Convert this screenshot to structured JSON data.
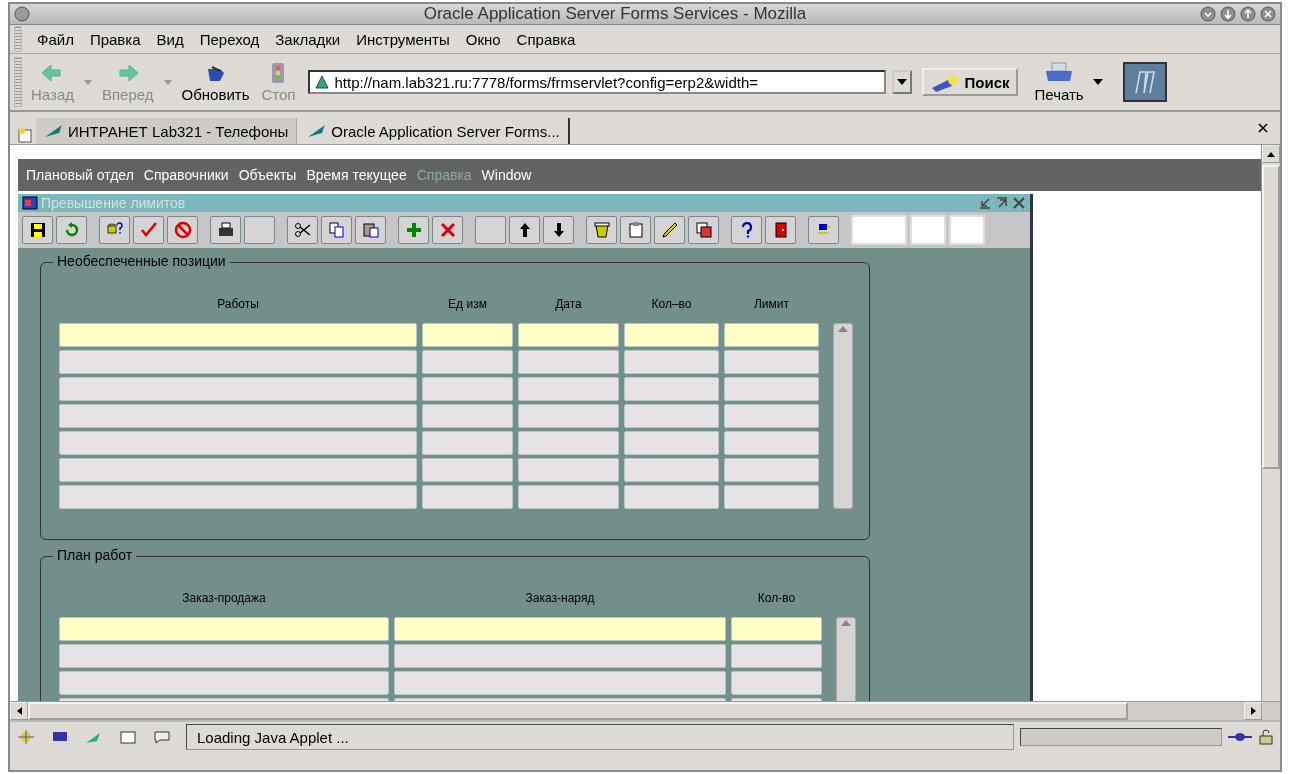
{
  "window": {
    "title": "Oracle Application Server Forms Services - Mozilla"
  },
  "menu": [
    "Файл",
    "Правка",
    "Вид",
    "Переход",
    "Закладки",
    "Инструменты",
    "Окно",
    "Справка"
  ],
  "nav_buttons": [
    {
      "kind": "back",
      "label": "Назад",
      "disabled": true
    },
    {
      "kind": "forward",
      "label": "Вперед",
      "disabled": true
    },
    {
      "kind": "reload",
      "label": "Обновить",
      "disabled": false
    },
    {
      "kind": "stop",
      "label": "Стоп",
      "disabled": true
    }
  ],
  "url": "http://nam.lab321.ru:7778/forms/frmservlet?config=erp2&width=",
  "search_button": "Поиск",
  "print_button": "Печать",
  "tabs": [
    {
      "label": "ИНТРАНЕТ Lab321 - Телефоны",
      "selected": false
    },
    {
      "label": "Oracle Application Server Forms...",
      "selected": true
    }
  ],
  "applet_menu": [
    {
      "label": "Плановый отдел",
      "disabled": false
    },
    {
      "label": "Справочники",
      "disabled": false
    },
    {
      "label": "Объекты",
      "disabled": false
    },
    {
      "label": "Время текущее",
      "disabled": false
    },
    {
      "label": "Справка",
      "disabled": true
    },
    {
      "label": "Window",
      "disabled": false
    }
  ],
  "form": {
    "title": "Превышение лимитов",
    "toolbar": [
      [
        {
          "kind": "save"
        },
        {
          "kind": "refresh"
        }
      ],
      [
        {
          "kind": "query"
        },
        {
          "kind": "check"
        },
        {
          "kind": "cancel"
        }
      ],
      [
        {
          "kind": "print"
        },
        {
          "kind": "blank"
        }
      ],
      [
        {
          "kind": "cut"
        },
        {
          "kind": "copy"
        },
        {
          "kind": "paste"
        }
      ],
      [
        {
          "kind": "insert"
        },
        {
          "kind": "delete"
        }
      ],
      [
        {
          "kind": "blank"
        },
        {
          "kind": "up"
        },
        {
          "kind": "down"
        }
      ],
      [
        {
          "kind": "trash"
        },
        {
          "kind": "clipboard"
        },
        {
          "kind": "edit"
        },
        {
          "kind": "pages"
        }
      ],
      [
        {
          "kind": "help"
        },
        {
          "kind": "exit"
        }
      ],
      [
        {
          "kind": "plug"
        }
      ],
      [
        {
          "kind": "field"
        },
        {
          "kind": "field"
        },
        {
          "kind": "field"
        }
      ]
    ],
    "sections": [
      {
        "title": "Необеспеченные позиции",
        "columns": [
          "Работы",
          "Ед изм",
          "Дата",
          "Кол–во",
          "Лимит"
        ],
        "rows": [
          {
            "selected": true
          },
          {
            "selected": false
          },
          {
            "selected": false
          },
          {
            "selected": false
          },
          {
            "selected": false
          },
          {
            "selected": false
          },
          {
            "selected": false
          }
        ]
      },
      {
        "title": "План работ",
        "columns": [
          "Заказ-продажа",
          "Заказ-наряд",
          "Кол-во"
        ],
        "rows": [
          {
            "selected": true
          },
          {
            "selected": false
          },
          {
            "selected": false
          },
          {
            "selected": false
          }
        ]
      }
    ]
  },
  "status_bar": {
    "text": "Loading Java Applet ...",
    "progress": {
      "level": 0
    }
  }
}
